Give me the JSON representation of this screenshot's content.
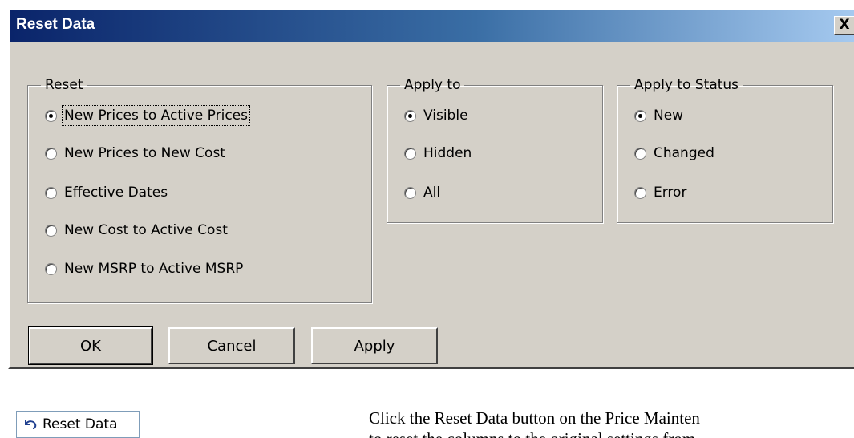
{
  "dialog": {
    "title": "Reset Data",
    "close_label": "X",
    "reset_group": {
      "legend": "Reset",
      "options": [
        {
          "label": "New Prices to Active Prices",
          "checked": true
        },
        {
          "label": "New Prices to New Cost",
          "checked": false
        },
        {
          "label": "Effective Dates",
          "checked": false
        },
        {
          "label": "New Cost to Active Cost",
          "checked": false
        },
        {
          "label": "New MSRP to Active MSRP",
          "checked": false
        }
      ]
    },
    "apply_to_group": {
      "legend": "Apply to",
      "options": [
        {
          "label": "Visible",
          "checked": true
        },
        {
          "label": "Hidden",
          "checked": false
        },
        {
          "label": "All",
          "checked": false
        }
      ]
    },
    "apply_to_status_group": {
      "legend": "Apply to Status",
      "options": [
        {
          "label": "New",
          "checked": true
        },
        {
          "label": "Changed",
          "checked": false
        },
        {
          "label": "Error",
          "checked": false
        }
      ]
    },
    "buttons": {
      "ok": "OK",
      "cancel": "Cancel",
      "apply": "Apply"
    }
  },
  "toolbar_button": {
    "label": "Reset Data",
    "icon": "undo-arrow-icon"
  },
  "description": {
    "line1": "Click the Reset Data button on the Price Mainten",
    "line2": "to reset the columns to the original settings from"
  },
  "colors": {
    "dialog_bg": "#d4d0c8",
    "title_gradient_start": "#0a246a",
    "title_gradient_end": "#a6caf0"
  }
}
